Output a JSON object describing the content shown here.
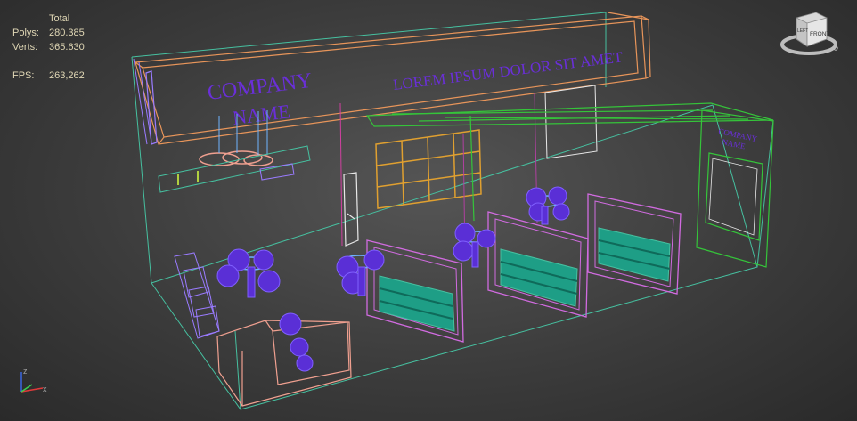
{
  "stats": {
    "header": "Total",
    "polys_label": "Polys:",
    "polys_value": "280.385",
    "verts_label": "Verts:",
    "verts_value": "365.630",
    "fps_label": "FPS:",
    "fps_value": "263,262"
  },
  "viewcube": {
    "face_front": "FRONT",
    "face_left": "LEFT",
    "icon": "cube-icon"
  },
  "scene": {
    "sign_company": "COMPANY",
    "sign_name": "NAME",
    "sign_lorem": "LOREM IPSUM DOLOR SIT AMET",
    "side_sign_1": "COMPANY",
    "side_sign_2": "NAME"
  },
  "axis": {
    "z": "z",
    "x": "x"
  },
  "colors": {
    "background": "#3c3c3c",
    "stats_text": "#e0d7b5",
    "wire_orange": "#e8955a",
    "wire_violet": "#9a7bff",
    "wire_green": "#35c43a",
    "wire_teal": "#46c0a0",
    "wire_magenta": "#d16be0",
    "furniture_blue": "#5a2fd6",
    "shelf_teal": "#1e9e86",
    "sign_text": "#6a2fd8"
  }
}
